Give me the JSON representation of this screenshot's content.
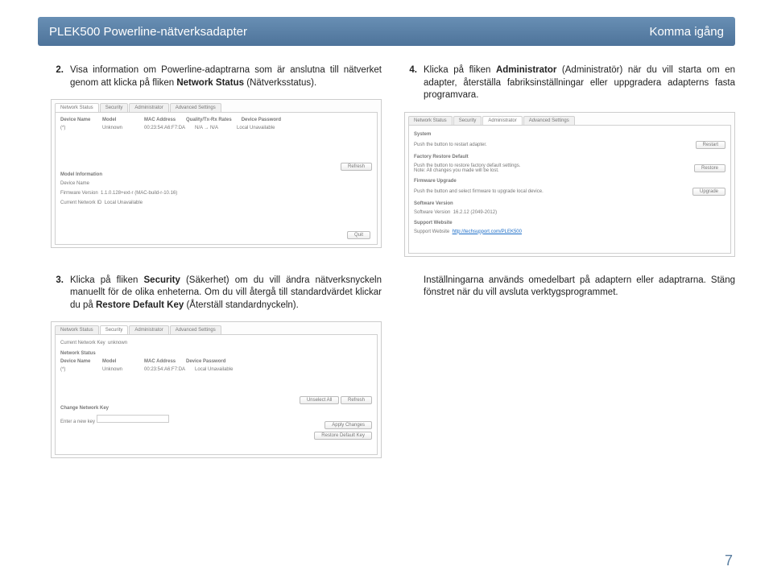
{
  "header": {
    "product_title": "PLEK500 Powerline-nätverksadapter",
    "section_title": "Komma igång"
  },
  "page_number": "7",
  "instructions": {
    "step2": {
      "num": "2.",
      "pre": "Visa information om Powerline-adaptrarna som är anslutna till nätverket genom att klicka på fliken ",
      "bold": "Network Status",
      "post": " (Nätverksstatus)."
    },
    "step3": {
      "num": "3.",
      "pre": "Klicka på fliken ",
      "bold1": "Security",
      "mid": " (Säkerhet) om du vill ändra nätverksnyckeln manuellt för de olika enheterna. Om du vill återgå till standardvärdet klickar du på ",
      "bold2": "Restore Default Key",
      "post": " (Återställ standardnyckeln)."
    },
    "step4": {
      "num": "4.",
      "pre": "Klicka på fliken ",
      "bold": "Administrator",
      "post": " (Administratör) när du vill starta om en adapter, återställa fabriksinställningar eller uppgradera adapterns fasta programvara."
    },
    "followup": "Inställningarna används omedelbart på adaptern eller adaptrarna. Stäng fönstret när du vill avsluta verktygsprogrammet."
  },
  "network_tab": {
    "tabs": [
      "Network Status",
      "Security",
      "Administrator",
      "Advanced Settings"
    ],
    "cols": [
      "Device Name",
      "Model",
      "MAC Address",
      "Quality/Tx-Rx Rates",
      "Device Password"
    ],
    "row": [
      "(*)",
      "Unknown",
      "00:23:54:A6:F7:DA",
      "N/A → N/A",
      "Local Unavailable"
    ],
    "info_hdr": "Model Information",
    "dev_name_lbl": "Device Name",
    "fw_lbl": "Firmware Version",
    "fw_val": "1.1.0.128+ext-r (MAC-build-r-10.16)",
    "net_lbl": "Current Network ID",
    "net_val": "Local Unavailable",
    "refresh_btn": "Refresh",
    "quit_btn": "Quit"
  },
  "admin_tab": {
    "tabs": [
      "Network Status",
      "Security",
      "Administrator",
      "Advanced Settings"
    ],
    "sys_hdr": "System",
    "restart_txt": "Push the button to restart adapter.",
    "restart_btn": "Restart",
    "fd_hdr": "Factory Restore Default",
    "fd_t1": "Push the button to restore factory default settings.",
    "fd_t2": "Note: All changes you made will be lost.",
    "fd_btn": "Restore",
    "fw_hdr": "Firmware Upgrade",
    "fw_txt": "Push the button and select firmware to upgrade local device.",
    "fw_btn": "Upgrade",
    "sw_hdr": "Software Version",
    "sw_lbl": "Software Version",
    "sw_val": "16.2.12 (2049-2012)",
    "sup_hdr": "Support Website",
    "sup_lbl": "Support Website",
    "sup_val": "http://techsupport.com/PLEK500"
  },
  "security_tab": {
    "tabs": [
      "Network Status",
      "Security",
      "Administrator",
      "Advanced Settings"
    ],
    "key_lbl": "Current Network Key",
    "key_val": "unknown",
    "status_hdr": "Network Status",
    "cols": [
      "Device Name",
      "Model",
      "MAC Address",
      "Device Password"
    ],
    "row": [
      "(*)",
      "Unknown",
      "00:23:54:A6:F7:DA",
      "Local Unavailable"
    ],
    "unsel_btn": "Unselect All",
    "ref_btn": "Refresh",
    "change_hdr": "Change Network Key",
    "enter_lbl": "Enter a new key",
    "apply_btn": "Apply Changes",
    "restore_btn": "Restore Default Key"
  }
}
